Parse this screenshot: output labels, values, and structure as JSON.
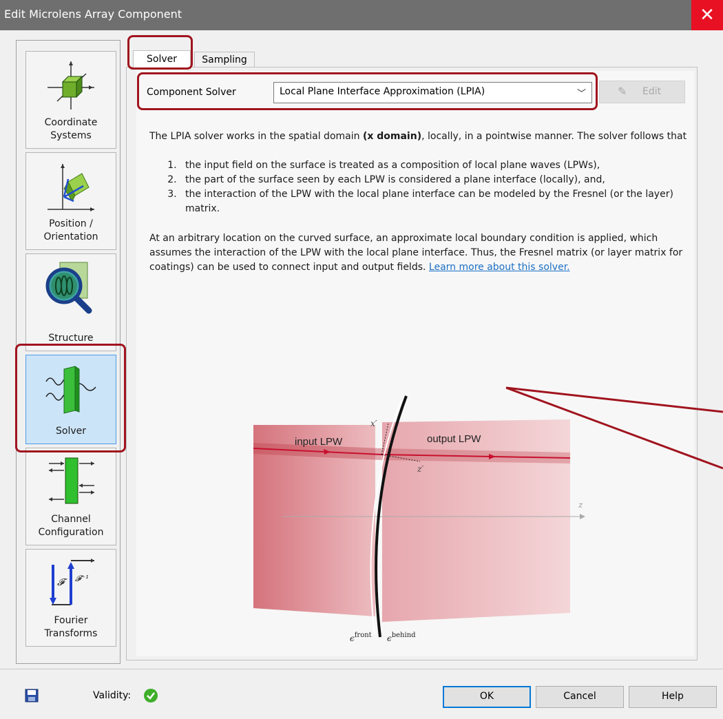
{
  "window": {
    "title": "Edit Microlens Array Component",
    "close_symbol": "✕"
  },
  "nav": {
    "items": [
      {
        "label": "Coordinate Systems",
        "icon": "coordinate-systems-icon"
      },
      {
        "label": "Position / Orientation",
        "icon": "position-orientation-icon"
      },
      {
        "label": "Structure",
        "icon": "structure-magnifier-icon"
      },
      {
        "label": "Solver",
        "icon": "solver-icon",
        "selected": true
      },
      {
        "label": "Channel Configuration",
        "icon": "channel-configuration-icon"
      },
      {
        "label": "Fourier Transforms",
        "icon": "fourier-transforms-icon"
      }
    ]
  },
  "tabs": [
    {
      "label": "Solver",
      "active": true
    },
    {
      "label": "Sampling",
      "active": false
    }
  ],
  "solver": {
    "label": "Component Solver",
    "selected": "Local Plane Interface Approximation (LPIA)",
    "edit_label": "Edit"
  },
  "description": {
    "intro_a": "The LPIA solver works in the spatial domain ",
    "intro_bold": "(x domain)",
    "intro_b": ", locally, in a pointwise manner. The solver follows that",
    "points": [
      "the input field on the surface is treated as a composition of local plane waves (LPWs),",
      "the part of the surface seen by each LPW is considered a plane interface (locally), and,",
      "the interaction of the LPW with the local plane interface can be modeled by the Fresnel (or the layer) matrix."
    ],
    "para2": "At an arbitrary location on the curved surface, an approximate local boundary condition is applied, which assumes the interaction of the LPW with the local plane interface. Thus, the Fresnel matrix (or layer matrix for coatings) can be used to connect input and output fields. ",
    "link": "Learn more about this solver."
  },
  "diagram": {
    "input_label": "input LPW",
    "output_label": "output LPW",
    "x_prime": "x′",
    "z_prime": "z′",
    "z_axis": "z",
    "eps_front_base": "ϵ",
    "eps_front_sup": "front",
    "eps_behind_base": "ϵ",
    "eps_behind_sup": "behind",
    "beam_color": "#d9707a",
    "ray_color": "#c8102e"
  },
  "footer": {
    "validity_label": "Validity:",
    "ok": "OK",
    "cancel": "Cancel",
    "help": "Help"
  },
  "colors": {
    "highlight": "#a0141e",
    "selected_nav": "#cce4f7",
    "link": "#1a6fc4"
  }
}
